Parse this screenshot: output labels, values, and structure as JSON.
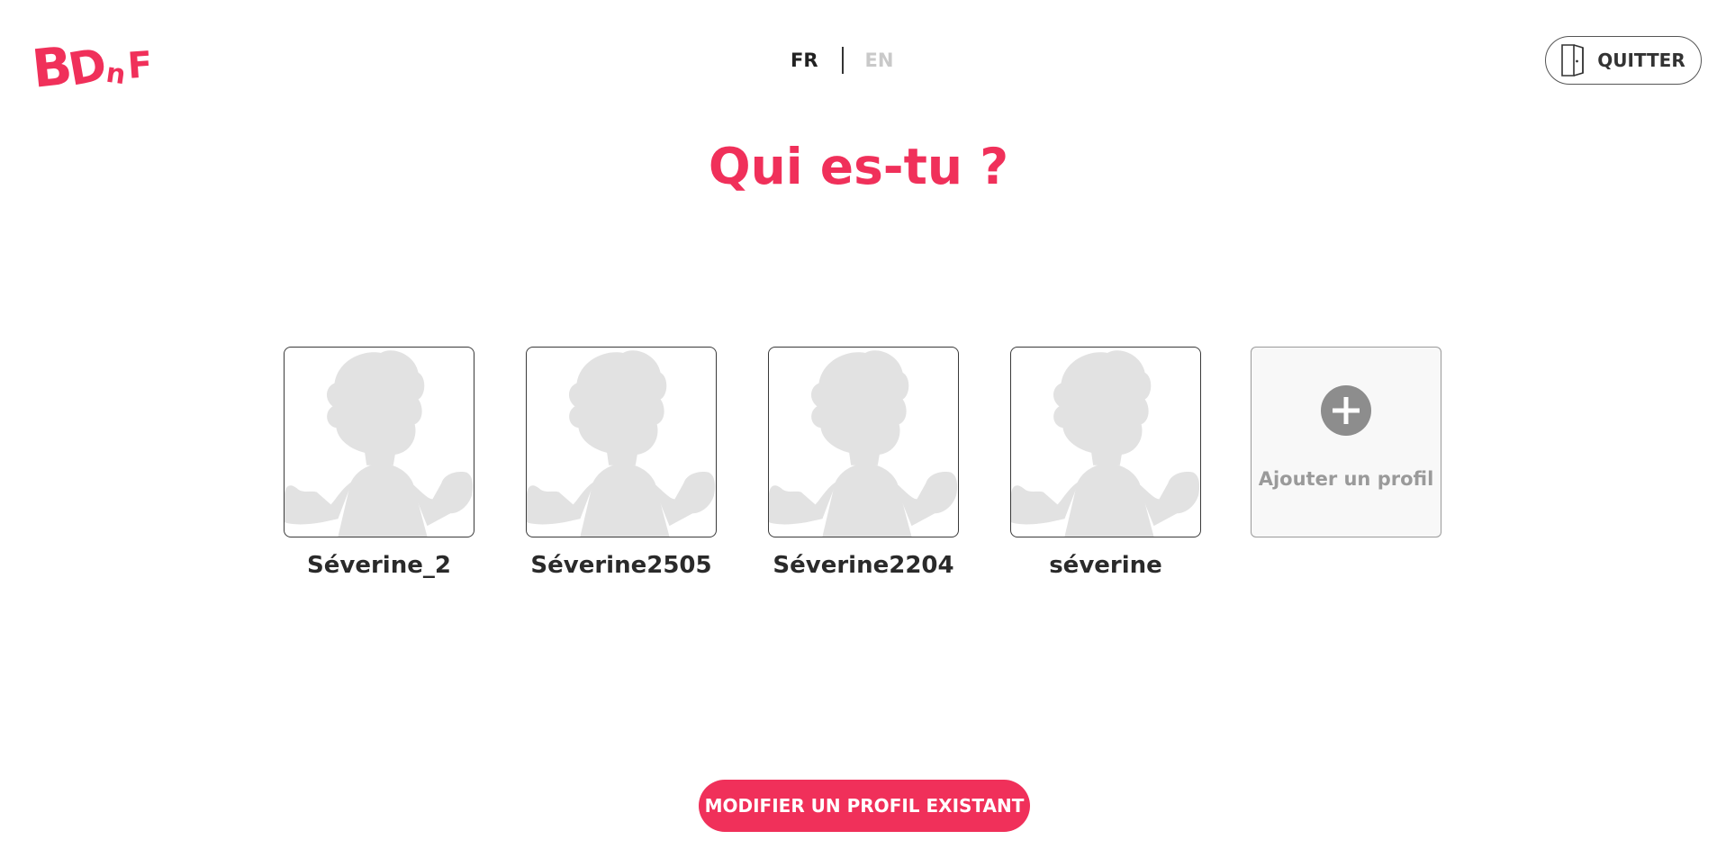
{
  "logo": {
    "text": "BDnF",
    "color": "#f0305a"
  },
  "language": {
    "options": [
      {
        "label": "FR",
        "active": true
      },
      {
        "label": "EN",
        "active": false
      }
    ]
  },
  "header": {
    "quit_label": "QUITTER",
    "quit_icon": "door-icon"
  },
  "title": "Qui es-tu ?",
  "profiles": [
    {
      "name": "Séverine_2"
    },
    {
      "name": "Séverine2505"
    },
    {
      "name": "Séverine2204"
    },
    {
      "name": "séverine"
    }
  ],
  "add_profile": {
    "label": "Ajouter un profil",
    "icon": "plus-icon"
  },
  "modify_button": {
    "label": "MODIFIER UN PROFIL EXISTANT"
  },
  "colors": {
    "accent": "#f0305a",
    "placeholder_silhouette": "#e2e2e2",
    "plus_circle": "#8d8d8d"
  }
}
